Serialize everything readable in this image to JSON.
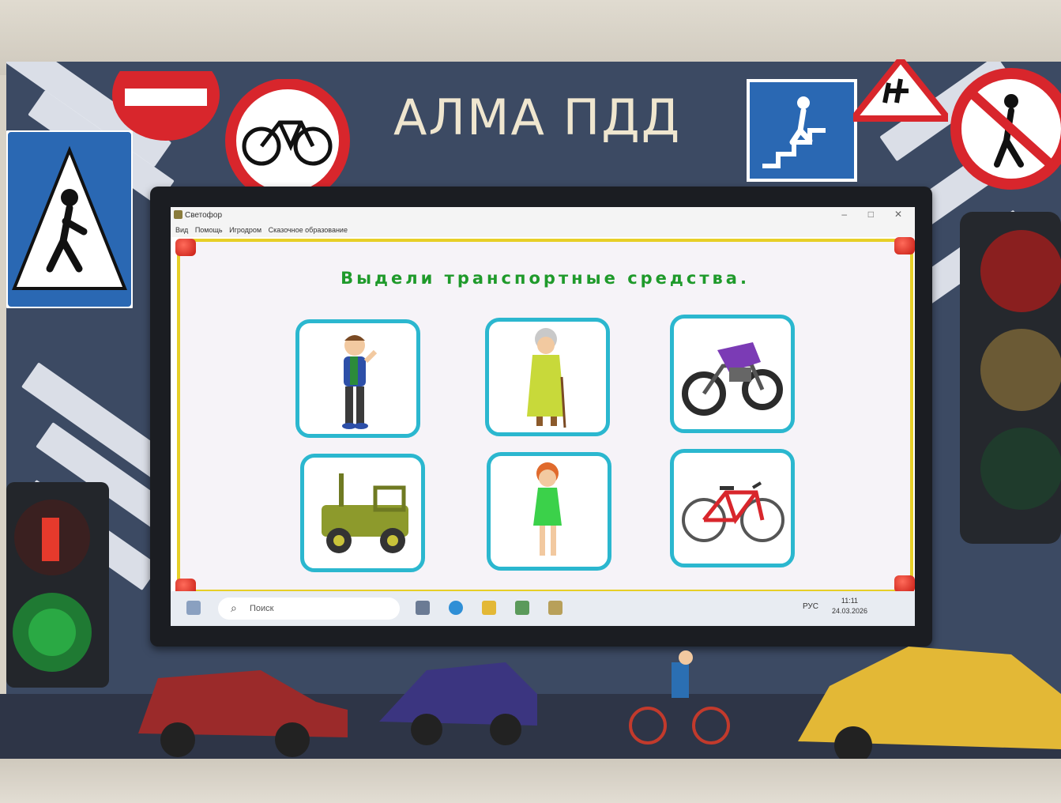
{
  "sign_board": {
    "title": "АЛМА ПДД"
  },
  "window": {
    "title": "Светофор",
    "controls": [
      "–",
      "□",
      "✕"
    ],
    "menu": [
      "Вид",
      "Помощь",
      "Игродром",
      "Сказочное образование"
    ]
  },
  "game": {
    "task": "Выдели транспортные средства.",
    "cards": [
      {
        "icon": "boy-icon"
      },
      {
        "icon": "grandmother-icon"
      },
      {
        "icon": "motorcycle-icon"
      },
      {
        "icon": "toy-car-icon"
      },
      {
        "icon": "woman-icon"
      },
      {
        "icon": "bicycle-icon"
      }
    ]
  },
  "taskbar": {
    "search_placeholder": "Поиск",
    "language": "РУС",
    "time": "11:11",
    "date": "24.03.2026"
  },
  "colors": {
    "board": "#3c4a63",
    "frame": "#e7cf27",
    "card_border": "#2bb7cf",
    "task_text": "#1f9a2b"
  }
}
